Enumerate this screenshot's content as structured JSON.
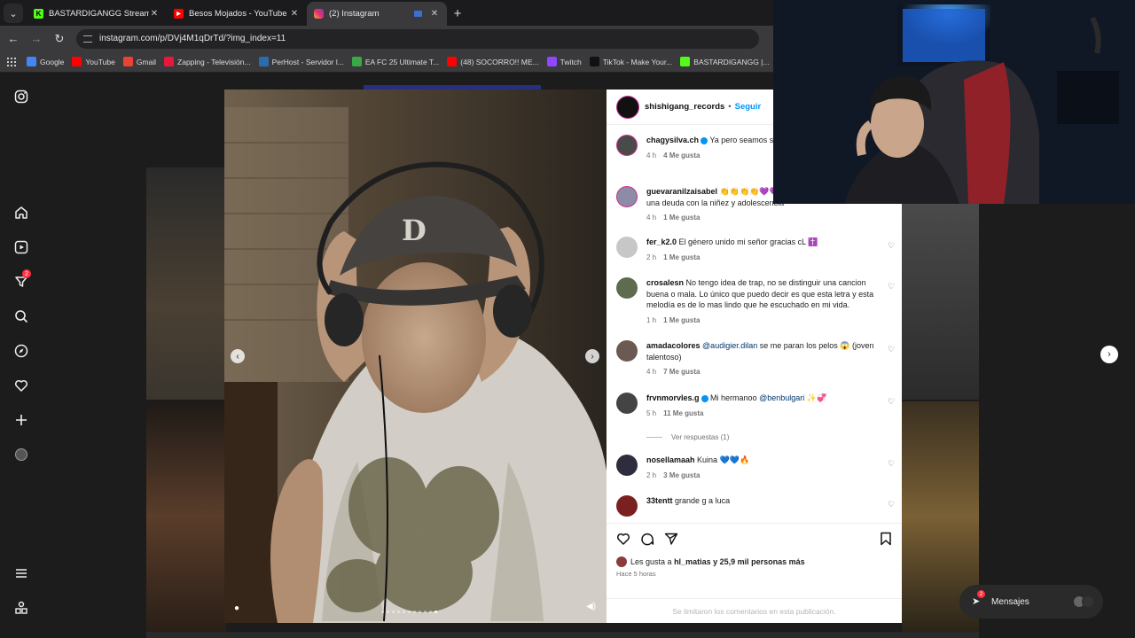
{
  "browser": {
    "tabs": [
      {
        "title": "BASTARDIGANGG Stream - Wat",
        "icon": "kick-logo",
        "color": "#53fc18",
        "active": false
      },
      {
        "title": "Besos Mojados - YouTube",
        "icon": "youtube-logo",
        "color": "#ff0000",
        "active": false
      },
      {
        "title": "(2) Instagram",
        "icon": "instagram-logo",
        "color": "#e1306c",
        "active": true
      }
    ],
    "url": "instagram.com/p/DVj4M1qDrTd/?img_index=11",
    "bookmarks": [
      {
        "label": "Google",
        "icon": "google-logo",
        "color": "#4285f4"
      },
      {
        "label": "YouTube",
        "icon": "youtube-logo",
        "color": "#ff0000"
      },
      {
        "label": "Gmail",
        "icon": "gmail-logo",
        "color": "#ea4335"
      },
      {
        "label": "Zapping - Televisión...",
        "icon": "zapping-logo",
        "color": "#e8173b"
      },
      {
        "label": "PerHost - Servidor l...",
        "icon": "perhost-logo",
        "color": "#2b6cb0"
      },
      {
        "label": "EA FC 25 Ultimate T...",
        "icon": "futbin-logo",
        "color": "#39a845"
      },
      {
        "label": "(48) SOCORRO!! ME...",
        "icon": "youtube-logo",
        "color": "#ff0000"
      },
      {
        "label": "Twitch",
        "icon": "twitch-logo",
        "color": "#9146ff"
      },
      {
        "label": "TikTok - Make Your...",
        "icon": "tiktok-logo",
        "color": "#111111"
      },
      {
        "label": "BASTARDIGANGG |...",
        "icon": "kick-logo",
        "color": "#53fc18"
      }
    ]
  },
  "instagram": {
    "notifications_badge": "2",
    "post": {
      "author": "shishigang_records",
      "follow_label": "Seguir",
      "carousel": {
        "count": 11,
        "current": 11
      },
      "liked_by_prefix": "Les gusta a",
      "liked_by_user": "hl_matias",
      "liked_by_rest": "y 25,9 mil personas más",
      "posted_ago": "Hace 5 horas",
      "comments_limited": "Se limitaron los comentarios en esta publicación."
    },
    "comments": [
      {
        "user": "chagysilva.ch",
        "verified": true,
        "text": "Ya pero seamos si... pone 🔥",
        "time": "4 h",
        "likes": "4 Me gusta",
        "avatar_color": "#4a4a4a",
        "ring": true
      },
      {
        "user": "guevaranilzaisabel",
        "verified": false,
        "text": "👏👏👏👏💜💜💜 El estado de Chile tiene una deuda con la niñez y adolescencia",
        "time": "4 h",
        "likes": "1 Me gusta",
        "avatar_color": "#8c8ca6",
        "ring": true
      },
      {
        "user": "fer_k2.0",
        "verified": false,
        "text": "El género unido mi señor gracias cL ✝️",
        "time": "2 h",
        "likes": "1 Me gusta",
        "avatar_color": "#c7c7c7",
        "ring": false
      },
      {
        "user": "crosalesn",
        "verified": false,
        "text": "No tengo idea de trap, no se distinguir una cancion buena o mala. Lo único que puedo decir es que esta letra y esta melodía es de lo mas lindo que he escuchado en mi vida.",
        "time": "1 h",
        "likes": "1 Me gusta",
        "avatar_color": "#5f6b4e",
        "ring": false
      },
      {
        "user": "amadacolores",
        "verified": false,
        "mention": "@audigier.dilan",
        "text": "se me paran los pelos 😱 (joven talentoso)",
        "time": "4 h",
        "likes": "7 Me gusta",
        "avatar_color": "#6b5a52",
        "ring": false
      },
      {
        "user": "frvnmorvles.g",
        "verified": true,
        "text": "Mi hermanoo",
        "mention": "@benbulgari",
        "text_after": "✨💞",
        "time": "5 h",
        "likes": "11 Me gusta",
        "avatar_color": "#444444",
        "ring": false,
        "replies": "Ver respuestas (1)"
      },
      {
        "user": "nosellamaah",
        "verified": false,
        "text": "Kuina 💙💙🔥",
        "time": "2 h",
        "likes": "3 Me gusta",
        "avatar_color": "#2d2d3d",
        "ring": false
      },
      {
        "user": "33tentt",
        "verified": false,
        "text": "grande g a luca",
        "time": "",
        "likes": "",
        "avatar_color": "#7a2020",
        "ring": false
      }
    ],
    "messages_label": "Mensajes",
    "messages_badge": "2"
  },
  "colors": {
    "accent": "#0095f6",
    "badge": "#ff3040",
    "story_ring": "#c72f8d"
  }
}
